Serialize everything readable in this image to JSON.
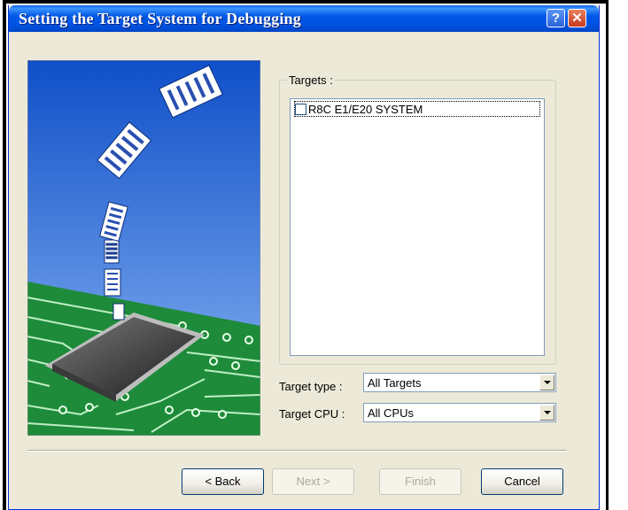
{
  "window": {
    "title": "Setting the Target System for Debugging",
    "help_glyph": "?",
    "close_glyph": "✕"
  },
  "targets": {
    "group_label": "Targets :",
    "items": [
      {
        "label": "R8C E1/E20 SYSTEM",
        "checked": false
      }
    ]
  },
  "target_type": {
    "label": "Target type :",
    "value": "All Targets"
  },
  "target_cpu": {
    "label": "Target CPU :",
    "value": "All CPUs"
  },
  "buttons": {
    "back": "< Back",
    "next": "Next >",
    "finish": "Finish",
    "cancel": "Cancel"
  },
  "illustration": {
    "icon": "chip-download-illustration"
  }
}
